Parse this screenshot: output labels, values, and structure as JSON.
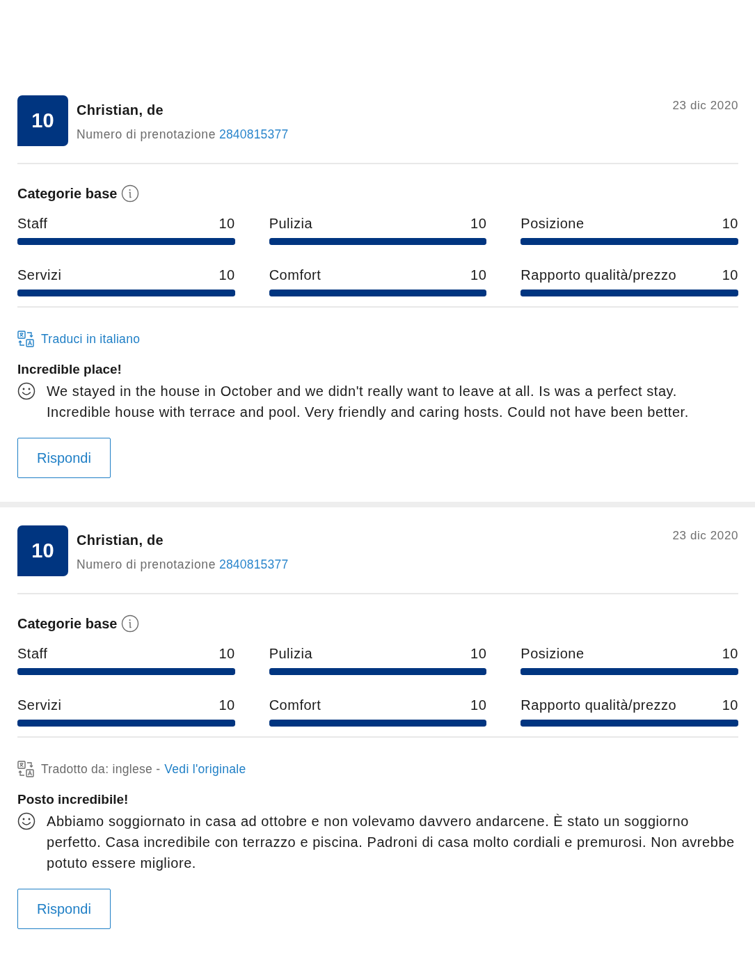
{
  "reviews": [
    {
      "score": "10",
      "name": "Christian, de",
      "booking_label": "Numero di prenotazione",
      "booking_number": "2840815377",
      "date": "23 dic 2020",
      "categories_title": "Categorie base",
      "categories": [
        {
          "label": "Staff",
          "value": "10",
          "level": 1
        },
        {
          "label": "Pulizia",
          "value": "10",
          "level": 1
        },
        {
          "label": "Posizione",
          "value": "10",
          "level": 1
        },
        {
          "label": "Servizi",
          "value": "10",
          "level": 1
        },
        {
          "label": "Comfort",
          "value": "10",
          "level": 1
        },
        {
          "label": "Rapporto qualità/prezzo",
          "value": "10",
          "level": 1
        }
      ],
      "translation": {
        "kind": "offer",
        "link": "Traduci in italiano"
      },
      "title": "Incredible place!",
      "text": "We stayed in the house in October and we didn't really want to leave at all. Is was a perfect stay. Incredible house with terrace and pool. Very friendly and caring hosts. Could not have been better.",
      "reply_button": "Rispondi"
    },
    {
      "score": "10",
      "name": "Christian, de",
      "booking_label": "Numero di prenotazione",
      "booking_number": "2840815377",
      "date": "23 dic 2020",
      "categories_title": "Categorie base",
      "categories": [
        {
          "label": "Staff",
          "value": "10",
          "level": 1
        },
        {
          "label": "Pulizia",
          "value": "10",
          "level": 1
        },
        {
          "label": "Posizione",
          "value": "10",
          "level": 1
        },
        {
          "label": "Servizi",
          "value": "10",
          "level": 1
        },
        {
          "label": "Comfort",
          "value": "10",
          "level": 1
        },
        {
          "label": "Rapporto qualità/prezzo",
          "value": "10",
          "level": 1
        }
      ],
      "translation": {
        "kind": "translated",
        "note": "Tradotto da: inglese -",
        "link": "Vedi l'originale"
      },
      "title": "Posto incredibile!",
      "text": "Abbiamo soggiornato in casa ad ottobre e non volevamo davvero andarcene. È stato un soggiorno perfetto. Casa incredibile con terrazzo e piscina. Padroni di casa molto cordiali e premurosi. Non avrebbe potuto essere migliore.",
      "reply_button": "Rispondi"
    }
  ]
}
